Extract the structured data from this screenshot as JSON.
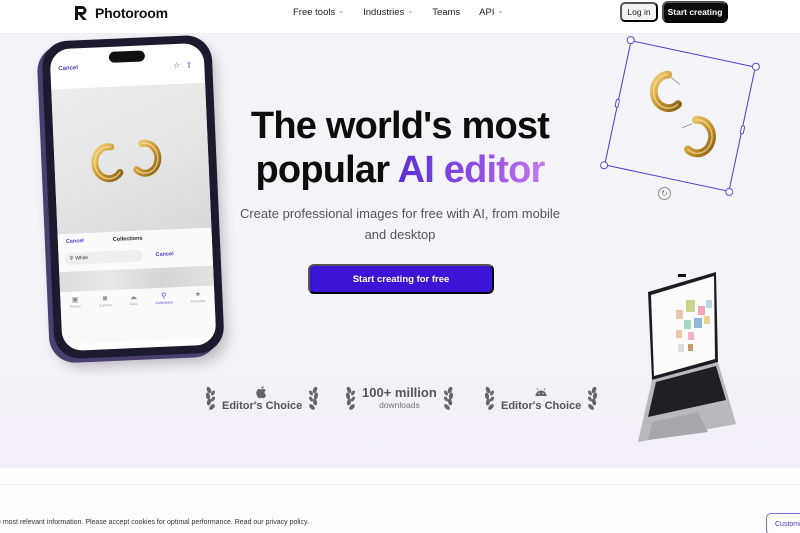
{
  "nav": {
    "brand": "Photoroom",
    "menu": [
      {
        "label": "Free tools",
        "has_dropdown": true
      },
      {
        "label": "Industries",
        "has_dropdown": true
      },
      {
        "label": "Teams",
        "has_dropdown": false
      },
      {
        "label": "API",
        "has_dropdown": true
      }
    ],
    "login_label": "Log in",
    "start_label": "Start creating",
    "chevron": "⌄"
  },
  "hero": {
    "title_line1": "The world's most",
    "title_line2_plain": "popular ",
    "title_line2_accent": "AI editor",
    "subtitle": "Create professional images for free with AI, from mobile and desktop",
    "cta_label": "Start creating for free",
    "colors": {
      "cta": "#3d13d6",
      "accent_start": "#5b2fd6",
      "accent_end": "#c57af0",
      "selection": "#4b3bd6"
    }
  },
  "badges": [
    {
      "icon": "apple-icon",
      "label": "Editor's Choice"
    },
    {
      "big": "100+ million",
      "small": "downloads"
    },
    {
      "icon": "android-icon",
      "label": "Editor's Choice"
    }
  ],
  "phone": {
    "cancel": "Cancel",
    "sheet_cancel": "Cancel",
    "sheet_title": "Collections",
    "search_value": "White",
    "search_cancel": "Cancel",
    "tabs": [
      {
        "label": "Photos",
        "glyph": "▣",
        "active": false
      },
      {
        "label": "Camera",
        "glyph": "◙",
        "active": false
      },
      {
        "label": "Files",
        "glyph": "☁",
        "active": false
      },
      {
        "label": "Collections",
        "glyph": "⚲",
        "active": true
      },
      {
        "label": "Favorites",
        "glyph": "★",
        "active": false
      }
    ]
  },
  "editor": {
    "rotate_glyph": "↻"
  },
  "cookie": {
    "text": "e most relevant information. Please accept cookies for optimal performance. Read our privacy policy.",
    "customize_label": "Customize"
  }
}
